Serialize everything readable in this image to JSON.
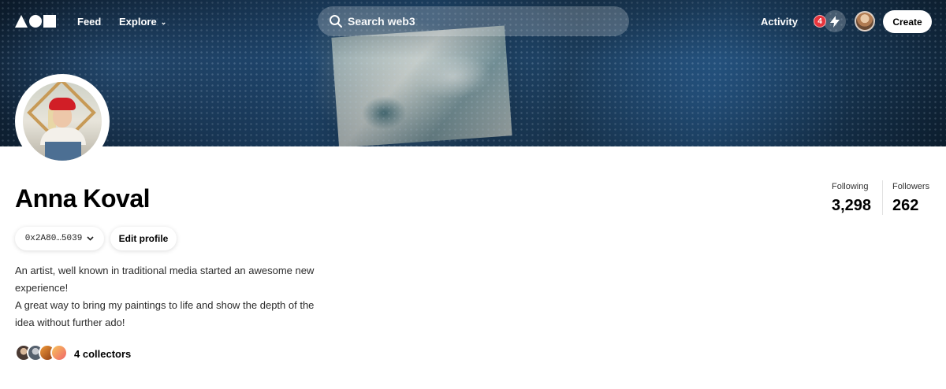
{
  "nav": {
    "feed": "Feed",
    "explore": "Explore",
    "search_placeholder": "Search web3",
    "activity": "Activity",
    "notification_count": "4",
    "create": "Create"
  },
  "profile": {
    "name": "Anna Koval",
    "wallet": "0x2A80…5039",
    "edit_profile": "Edit profile",
    "bio": [
      "An artist, well known in traditional media started an awesome new experience!",
      "A great way to bring my paintings to life and show the depth of the idea without further ado!"
    ],
    "collectors_label": "4 collectors"
  },
  "stats": {
    "following_label": "Following",
    "following_value": "3,298",
    "followers_label": "Followers",
    "followers_value": "262"
  },
  "colors": {
    "badge": "#e8353d",
    "banner_blue": "#24507a"
  },
  "icons": [
    "logo",
    "search-icon",
    "chevron-down-icon",
    "lightning-icon",
    "avatar"
  ]
}
